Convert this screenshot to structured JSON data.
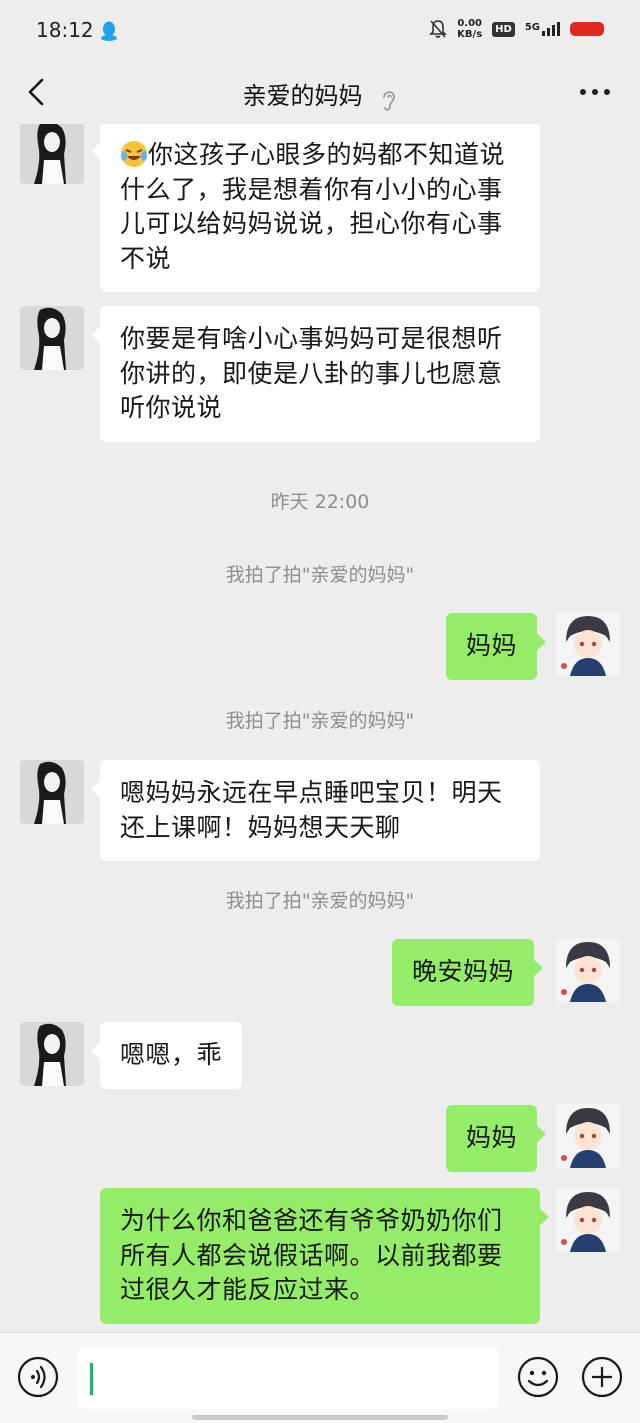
{
  "status_bar": {
    "time": "18:12",
    "speed_value": "0.00",
    "speed_unit": "KB/s",
    "hd": "HD",
    "network": "5G",
    "icons": [
      "qq-icon",
      "mute-bell-icon",
      "signal-icon",
      "battery-icon"
    ]
  },
  "header": {
    "title": "亲爱的妈妈",
    "icons": [
      "back-arrow-icon",
      "ear-icon",
      "more-dots-icon"
    ]
  },
  "messages": [
    {
      "from": "mom",
      "emoji": "laugh-cry-emoji",
      "lines": [
        "你这孩子心眼多的妈都不知道说",
        "什么了，我是想着你有小小的心事",
        "儿可以给妈妈说说，担心你有心事",
        "不说"
      ]
    },
    {
      "from": "mom",
      "lines": [
        "你要是有啥小心事妈妈可是很想听",
        "你讲的，即使是八卦的事儿也愿意",
        "听你说说"
      ]
    },
    {
      "type": "time",
      "text": "昨天 22:00"
    },
    {
      "type": "system",
      "text": "我拍了拍\"亲爱的妈妈\""
    },
    {
      "from": "me",
      "lines": [
        "妈妈"
      ]
    },
    {
      "type": "system",
      "text": "我拍了拍\"亲爱的妈妈\""
    },
    {
      "from": "mom",
      "lines": [
        "嗯妈妈永远在早点睡吧宝贝！明天",
        "还上课啊！妈妈想天天聊"
      ]
    },
    {
      "type": "system",
      "text": "我拍了拍\"亲爱的妈妈\""
    },
    {
      "from": "me",
      "lines": [
        "晚安妈妈"
      ]
    },
    {
      "from": "mom",
      "lines": [
        "嗯嗯，乖"
      ]
    },
    {
      "from": "me",
      "lines": [
        "妈妈"
      ]
    },
    {
      "from": "me",
      "lines": [
        "为什么你和爸爸还有爷爷奶奶你们",
        "所有人都会说假话啊。以前我都要",
        "过很久才能反应过来。"
      ]
    }
  ],
  "input_bar": {
    "text_value": "",
    "icons": [
      "voice-icon",
      "emoji-icon",
      "plus-icon"
    ]
  },
  "colors": {
    "background": "#ededed",
    "bubble_in": "#ffffff",
    "bubble_out": "#95ec69",
    "system_text": "#8e8e8e",
    "caret": "#07c160"
  }
}
